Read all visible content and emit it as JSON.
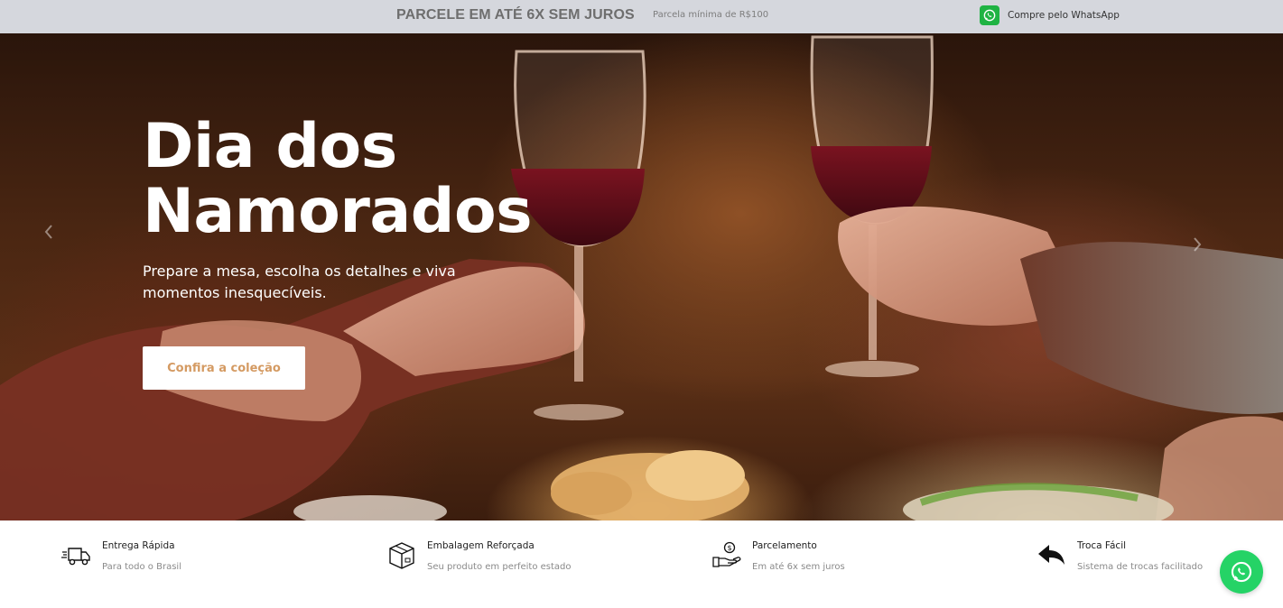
{
  "topbar": {
    "promo": "PARCELE EM ATÉ 6X SEM JUROS",
    "min_installment": "Parcela mínima de R$100",
    "whatsapp_label": "Compre pelo WhatsApp",
    "whatsapp_icon": "whatsapp-icon"
  },
  "hero": {
    "title": "Dia dos Namorados",
    "subtitle": "Prepare a mesa, escolha os detalhes e viva momentos inesquecíveis.",
    "cta_label": "Confira a coleção",
    "prev_icon": "chevron-left-icon",
    "next_icon": "chevron-right-icon"
  },
  "features": [
    {
      "icon": "truck-icon",
      "title": "Entrega Rápida",
      "subtitle": "Para todo o Brasil"
    },
    {
      "icon": "box-icon",
      "title": "Embalagem Reforçada",
      "subtitle": "Seu produto em perfeito estado"
    },
    {
      "icon": "hand-money-icon",
      "title": "Parcelamento",
      "subtitle": "Em até 6x sem juros"
    },
    {
      "icon": "return-arrow-icon",
      "title": "Troca Fácil",
      "subtitle": "Sistema de trocas facilitado"
    }
  ],
  "floating_whatsapp": {
    "icon": "whatsapp-icon"
  },
  "colors": {
    "topbar_bg": "#d5d7dd",
    "cta_text": "#d49a62",
    "whatsapp_green": "#25d366"
  }
}
